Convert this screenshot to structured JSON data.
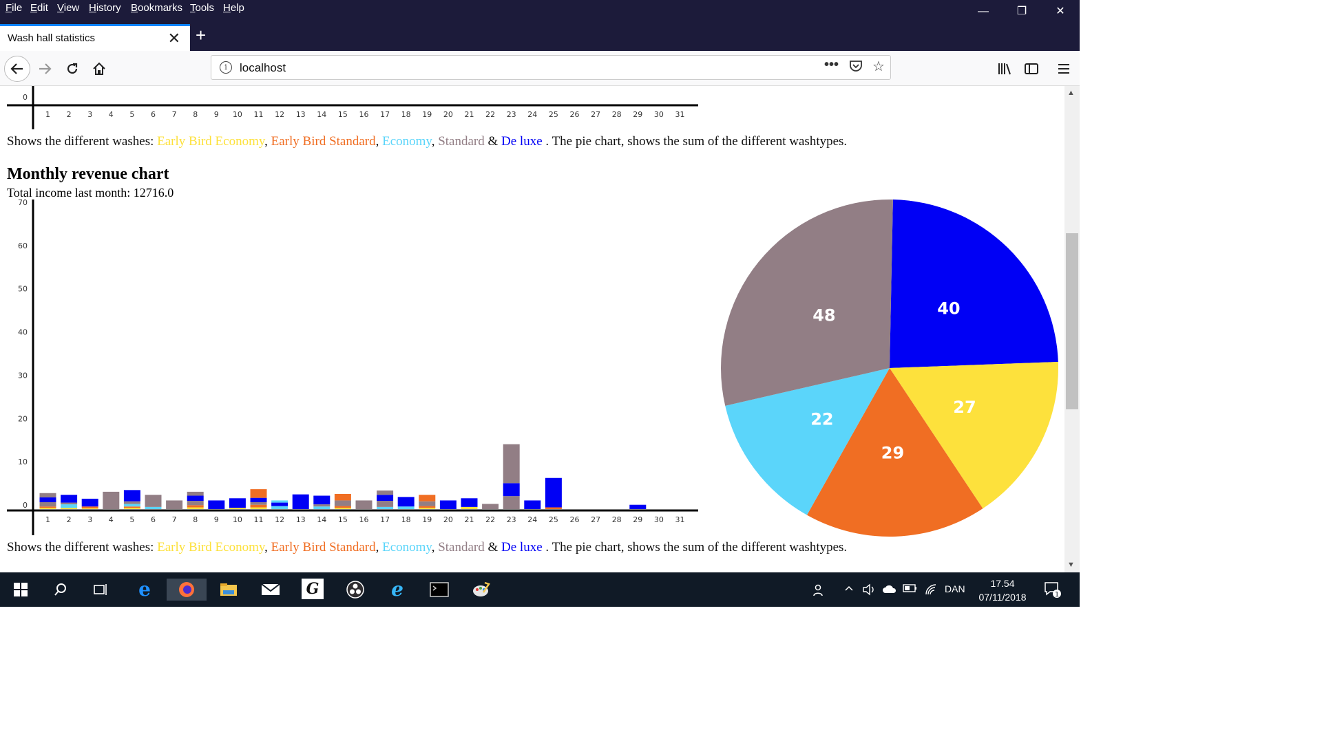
{
  "menu": [
    "File",
    "Edit",
    "View",
    "History",
    "Bookmarks",
    "Tools",
    "Help"
  ],
  "menu_underline": [
    "F",
    "E",
    "V",
    "H",
    "B",
    "T",
    "H"
  ],
  "window_controls": {
    "minimize": "—",
    "restore": "❐",
    "close": "✕"
  },
  "tab": {
    "title": "Wash hall statistics",
    "close": "✕"
  },
  "new_tab": "+",
  "url": "localhost",
  "taskbar": {
    "language": "DAN",
    "time": "17.54",
    "date": "07/11/2018",
    "notification_count": "1"
  },
  "washes_text": {
    "intro": "Shows the different washes: ",
    "ebe": "Early Bird Economy",
    "ebs": "Early Bird Standard",
    "eco": "Economy",
    "std": "Standard",
    "amp": " & ",
    "dlx": "De luxe",
    "outro": " . The pie chart, shows the sum of the different washtypes.",
    "sep": ", "
  },
  "heading": "Monthly revenue chart",
  "total_income": "Total income last month: 12716.0",
  "colors": {
    "ebe": "#fde13c",
    "ebs": "#f06e23",
    "eco": "#5bd5fa",
    "std": "#927e85",
    "dlx": "#0000f5"
  },
  "chart_data": [
    {
      "type": "bar",
      "stacked": true,
      "categories": [
        "1",
        "2",
        "3",
        "4",
        "5",
        "6",
        "7",
        "8",
        "9",
        "10",
        "11",
        "12",
        "13",
        "14",
        "15",
        "16",
        "17",
        "18",
        "19",
        "20",
        "21",
        "22",
        "23",
        "24",
        "25",
        "26",
        "27",
        "28",
        "29",
        "30",
        "31"
      ],
      "ylim": [
        0,
        70
      ],
      "yticks": [
        0,
        10,
        20,
        30,
        40,
        50,
        60,
        70
      ],
      "series": [
        {
          "name": "Early Bird Economy",
          "color": "#fde13c",
          "values": [
            0.3,
            0.3,
            0.2,
            0,
            0.3,
            0,
            0,
            0.4,
            0,
            0.3,
            0.4,
            0,
            0,
            0,
            0.3,
            0,
            0,
            0,
            0.3,
            0,
            0.5,
            0,
            0,
            0,
            0,
            0,
            0,
            0,
            0,
            0,
            0
          ]
        },
        {
          "name": "Early Bird Standard",
          "color": "#f06e23",
          "values": [
            0.3,
            0,
            0.4,
            0,
            0.3,
            0,
            0,
            0.5,
            0,
            0,
            0.6,
            0,
            0,
            0,
            0.4,
            0,
            0,
            0,
            0.4,
            0,
            0,
            0,
            0,
            0,
            0.4,
            0,
            0,
            0,
            0,
            0,
            0
          ]
        },
        {
          "name": "Economy",
          "color": "#5bd5fa",
          "values": [
            0,
            0.8,
            0,
            0,
            0.6,
            0.5,
            0,
            0,
            0,
            0,
            0,
            0.7,
            0,
            0.6,
            0,
            0,
            0.5,
            0.6,
            0,
            0,
            0,
            0,
            0,
            0,
            0,
            0,
            0,
            0,
            0,
            0,
            0
          ]
        },
        {
          "name": "Standard",
          "color": "#927e85",
          "values": [
            1,
            0.4,
            0,
            4,
            0.6,
            2.8,
            2,
            1,
            0,
            0,
            0.6,
            0,
            0,
            0.5,
            1.3,
            2,
            1.4,
            0,
            1.1,
            0,
            0,
            1.2,
            3,
            0,
            0,
            0,
            0,
            0,
            0,
            0,
            0
          ]
        },
        {
          "name": "De luxe",
          "color": "#0000f5",
          "values": [
            1.1,
            1.8,
            1.8,
            0,
            2.6,
            0,
            0,
            1.2,
            2,
            2.2,
            1,
            0.8,
            3.4,
            2,
            0,
            0,
            1.4,
            2.2,
            0,
            2,
            2,
            0,
            3,
            2,
            6.8,
            0,
            0,
            0,
            1,
            0,
            0
          ]
        },
        {
          "name": "Standard",
          "color": "#927e85",
          "values": [
            1,
            0,
            0,
            0,
            0,
            0,
            0,
            0.9,
            0,
            0,
            0,
            0,
            0,
            0,
            0,
            0,
            1,
            0,
            0,
            0,
            0,
            0,
            9,
            0,
            0,
            0,
            0,
            0,
            0,
            0,
            0
          ]
        },
        {
          "name": "Early Bird Standard",
          "color": "#f06e23",
          "values": [
            0,
            0,
            0,
            0,
            0,
            0,
            0,
            0,
            0,
            0,
            2,
            0,
            0,
            0,
            1.5,
            0,
            0,
            0,
            1.5,
            0,
            0,
            0,
            0,
            0,
            0,
            0,
            0,
            0,
            0,
            0,
            0
          ]
        },
        {
          "name": "Economy",
          "color": "#5bd5fa",
          "values": [
            0,
            0,
            0,
            0,
            0,
            0,
            0,
            0,
            0,
            0,
            0,
            0.5,
            0,
            0,
            0,
            0,
            0,
            0,
            0,
            0,
            0,
            0,
            0,
            0,
            0,
            0,
            0,
            0,
            0,
            0,
            0
          ]
        }
      ]
    },
    {
      "type": "pie",
      "slices": [
        {
          "label": "40",
          "value": 40,
          "color": "#0000f5"
        },
        {
          "label": "27",
          "value": 27,
          "color": "#fde13c"
        },
        {
          "label": "29",
          "value": 29,
          "color": "#f06e23"
        },
        {
          "label": "22",
          "value": 22,
          "color": "#5bd5fa"
        },
        {
          "label": "48",
          "value": 48,
          "color": "#927e85"
        }
      ]
    }
  ],
  "top_axis": {
    "zero": "0"
  }
}
